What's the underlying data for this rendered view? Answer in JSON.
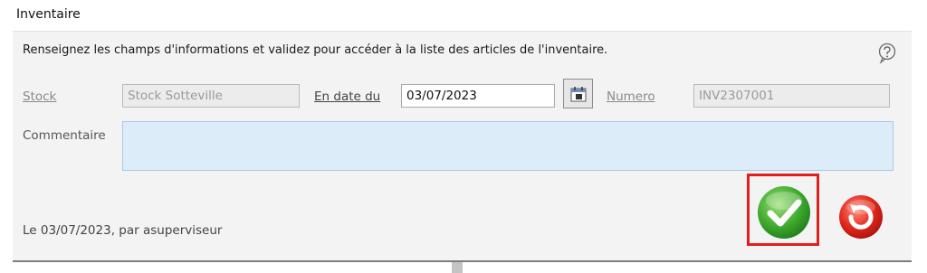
{
  "header": {
    "title": "Inventaire"
  },
  "panel": {
    "instructions": "Renseignez les champs d'informations et validez pour accéder à la liste des articles de l'inventaire.",
    "help_icon": "help-question-icon"
  },
  "form": {
    "stock_label": "Stock",
    "stock_value": "Stock Sotteville",
    "date_label": "En date du",
    "date_value": "03/07/2023",
    "calendar_icon": "calendar-icon",
    "numero_label": "Numero",
    "numero_value": "INV2307001",
    "comment_label": "Commentaire",
    "comment_value": ""
  },
  "footer": {
    "status_text": "Le 03/07/2023, par asuperviseur",
    "validate_icon": "check-icon",
    "cancel_icon": "undo-icon",
    "highlight_color": "#e01f1f"
  }
}
